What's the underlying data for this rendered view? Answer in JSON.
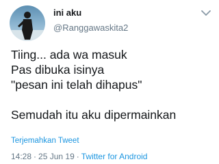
{
  "author": {
    "display_name": "ini aku",
    "handle": "@Ranggawaskita2",
    "avatar_icon": "profile-photo-person-silhouette"
  },
  "menu_icon": "chevron-down-icon",
  "tweet": {
    "lines": [
      "Tiing... ada wa masuk",
      "Pas dibuka isinya",
      "\"pesan ini telah dihapus\"",
      "",
      "Semudah itu aku dipermainkan"
    ]
  },
  "translate_label": "Terjemahkan Tweet",
  "meta": {
    "time": "14:28",
    "date": "25 Jun 19",
    "separator": "·",
    "source": "Twitter for Android"
  },
  "colors": {
    "text": "#14171a",
    "muted": "#657786",
    "link": "#1b95e0"
  }
}
